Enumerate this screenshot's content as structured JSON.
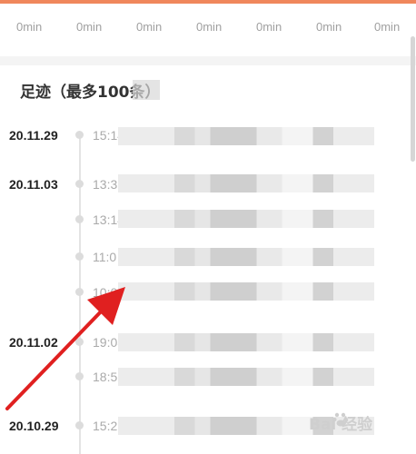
{
  "time_strip": [
    "0min",
    "0min",
    "0min",
    "0min",
    "0min",
    "0min",
    "0min"
  ],
  "section_title": "足迹（最多100条）",
  "groups": [
    {
      "date": "20.11.29",
      "times": [
        "15:14"
      ]
    },
    {
      "date": "20.11.03",
      "times": [
        "13:3",
        "13:14",
        "11:0",
        "10:03"
      ]
    },
    {
      "date": "20.11.02",
      "times": [
        "19:03",
        "18:52"
      ]
    },
    {
      "date": "20.10.29",
      "times": [
        "15:2"
      ]
    }
  ],
  "watermark": "Bai 经验",
  "colors": {
    "accent": "#f0875c",
    "arrow": "#e02020"
  }
}
